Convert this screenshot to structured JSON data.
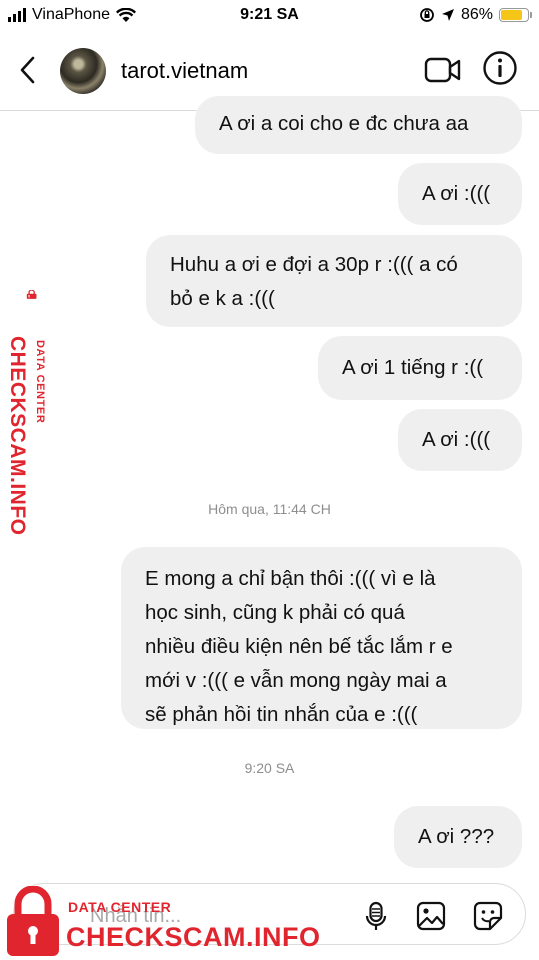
{
  "status_bar": {
    "carrier": "VinaPhone",
    "time": "9:21 SA",
    "battery_percent": "86%",
    "battery_level": 0.86,
    "battery_color": "#f5c518"
  },
  "header": {
    "username": "tarot.vietnam",
    "back_icon": "chevron-left-icon",
    "video_icon": "video-camera-icon",
    "info_icon": "info-icon"
  },
  "messages": [
    {
      "text": "A ơi a coi cho e đc chưa aa",
      "sender": "me"
    },
    {
      "text": "A ơi :(((",
      "sender": "me"
    },
    {
      "lines": [
        "Huhu a ơi e đợi a 30p r :((( a có",
        "bỏ e k a :((("
      ],
      "sender": "me"
    },
    {
      "text": "A ơi 1 tiếng r :((",
      "sender": "me"
    },
    {
      "text": "A ơi :(((",
      "sender": "me"
    },
    {
      "lines": [
        "E mong a chỉ bận thôi :((( vì e là",
        "học sinh, cũng k phải có quá",
        "nhiều điều kiện nên bế tắc lắm r e",
        "mới v :((( e vẫn mong ngày mai a",
        "sẽ phản hồi tin nhắn của e :((("
      ],
      "sender": "me"
    },
    {
      "text": "A ơi ???",
      "sender": "me"
    }
  ],
  "timestamps": [
    "Hôm qua, 11:44 CH",
    "9:20 SA"
  ],
  "composer": {
    "placeholder": "Nhắn tin...",
    "icons": [
      "microphone-icon",
      "gallery-icon",
      "sticker-icon"
    ]
  },
  "watermark": {
    "small": "DATA CENTER",
    "big": "CHECKSCAM.INFO",
    "color": "#e0252e"
  },
  "colors": {
    "bubble": "#efefef",
    "timestamp": "#8e8e8e",
    "divider": "#dbdbdb"
  }
}
